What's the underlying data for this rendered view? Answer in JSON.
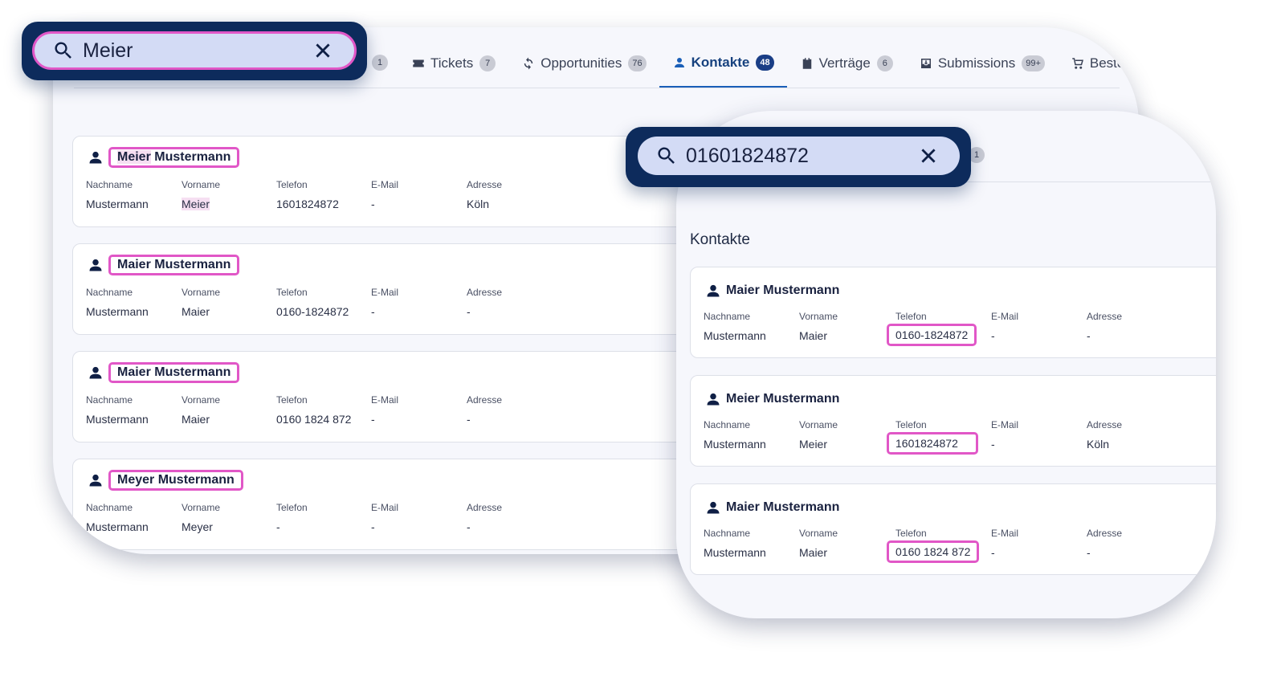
{
  "tabs": [
    {
      "label": "Tickets",
      "count": "7",
      "icon": "ticket-icon"
    },
    {
      "label": "Opportunities",
      "count": "76",
      "icon": "refresh-icon"
    },
    {
      "label": "Kontakte",
      "count": "48",
      "icon": "person-icon",
      "active": true
    },
    {
      "label": "Verträge",
      "count": "6",
      "icon": "clipboard-icon"
    },
    {
      "label": "Submissions",
      "count": "99+",
      "icon": "inbox-icon"
    },
    {
      "label": "Bestellun",
      "icon": "cart-icon"
    }
  ],
  "prev_tab_count": "1",
  "search1": {
    "value": "Meier"
  },
  "search2": {
    "value": "01601824872",
    "side_count": "1"
  },
  "labels": {
    "nachname": "Nachname",
    "vorname": "Vorname",
    "telefon": "Telefon",
    "email": "E-Mail",
    "adresse": "Adresse"
  },
  "results_left": [
    {
      "name": "Meier Mustermann",
      "nachname": "Mustermann",
      "vorname": "Meier",
      "telefon": "1601824872",
      "email": "-",
      "adresse": "Köln"
    },
    {
      "name": "Maier Mustermann",
      "nachname": "Mustermann",
      "vorname": "Maier",
      "telefon": "0160-1824872",
      "email": "-",
      "adresse": "-"
    },
    {
      "name": "Maier Mustermann",
      "nachname": "Mustermann",
      "vorname": "Maier",
      "telefon": "0160 1824 872",
      "email": "-",
      "adresse": "-"
    },
    {
      "name": "Meyer Mustermann",
      "nachname": "Mustermann",
      "vorname": "Meyer",
      "telefon": "-",
      "email": "-",
      "adresse": "-"
    }
  ],
  "front_title": "Kontakte",
  "results_right": [
    {
      "name": "Maier Mustermann",
      "nachname": "Mustermann",
      "vorname": "Maier",
      "telefon": "0160-1824872",
      "email": "-",
      "adresse": "-"
    },
    {
      "name": "Meier Mustermann",
      "nachname": "Mustermann",
      "vorname": "Meier",
      "telefon": "1601824872",
      "email": "-",
      "adresse": "Köln"
    },
    {
      "name": "Maier Mustermann",
      "nachname": "Mustermann",
      "vorname": "Maier",
      "telefon": "0160 1824 872",
      "email": "-",
      "adresse": "-"
    }
  ],
  "colors": {
    "navy": "#0d2b5c",
    "highlight": "#e157c7",
    "accent": "#1a5fb8",
    "pill": "#d3dbf5"
  }
}
